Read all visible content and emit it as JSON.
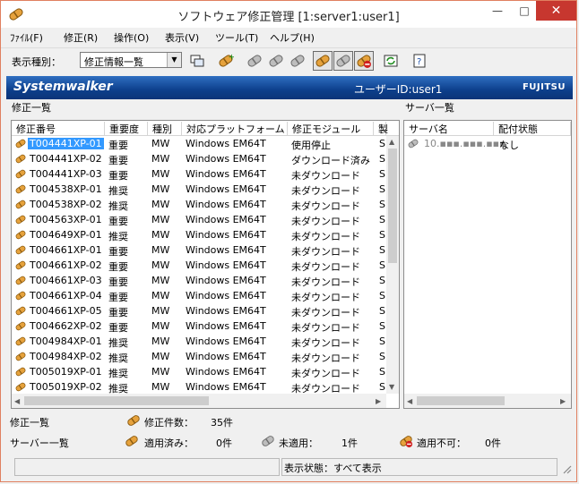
{
  "window": {
    "title": "ソフトウェア修正管理 [1:server1:user1]",
    "minimize_glyph": "—",
    "maximize_glyph": "□",
    "close_glyph": "✕"
  },
  "menu": [
    "ﾌｧｲﾙ(F)",
    "修正(R)",
    "操作(O)",
    "表示(V)",
    "ツール(T)",
    "ヘルプ(H)"
  ],
  "toolbar": {
    "display_type_label": "表示種別：",
    "display_type_value": "修正情報一覧"
  },
  "banner": {
    "logo": "Systemwalker",
    "user": "ユーザーID:user1",
    "vendor": "FUJITSU"
  },
  "patch_panel": {
    "title": "修正一覧",
    "columns": [
      "修正番号",
      "重要度",
      "種別",
      "対応プラットフォーム",
      "修正モジュール",
      "製"
    ],
    "rows": [
      {
        "id": "T004441XP-01",
        "importance": "重要",
        "type": "MW",
        "platform": "Windows EM64T",
        "module": "使用停止",
        "extra": "S"
      },
      {
        "id": "T004441XP-02",
        "importance": "重要",
        "type": "MW",
        "platform": "Windows EM64T",
        "module": "ダウンロード済み",
        "extra": "S"
      },
      {
        "id": "T004441XP-03",
        "importance": "重要",
        "type": "MW",
        "platform": "Windows EM64T",
        "module": "未ダウンロード",
        "extra": "S"
      },
      {
        "id": "T004538XP-01",
        "importance": "推奨",
        "type": "MW",
        "platform": "Windows EM64T",
        "module": "未ダウンロード",
        "extra": "S"
      },
      {
        "id": "T004538XP-02",
        "importance": "推奨",
        "type": "MW",
        "platform": "Windows EM64T",
        "module": "未ダウンロード",
        "extra": "S"
      },
      {
        "id": "T004563XP-01",
        "importance": "重要",
        "type": "MW",
        "platform": "Windows EM64T",
        "module": "未ダウンロード",
        "extra": "S"
      },
      {
        "id": "T004649XP-01",
        "importance": "推奨",
        "type": "MW",
        "platform": "Windows EM64T",
        "module": "未ダウンロード",
        "extra": "S"
      },
      {
        "id": "T004661XP-01",
        "importance": "重要",
        "type": "MW",
        "platform": "Windows EM64T",
        "module": "未ダウンロード",
        "extra": "S"
      },
      {
        "id": "T004661XP-02",
        "importance": "重要",
        "type": "MW",
        "platform": "Windows EM64T",
        "module": "未ダウンロード",
        "extra": "S"
      },
      {
        "id": "T004661XP-03",
        "importance": "重要",
        "type": "MW",
        "platform": "Windows EM64T",
        "module": "未ダウンロード",
        "extra": "S"
      },
      {
        "id": "T004661XP-04",
        "importance": "重要",
        "type": "MW",
        "platform": "Windows EM64T",
        "module": "未ダウンロード",
        "extra": "S"
      },
      {
        "id": "T004661XP-05",
        "importance": "重要",
        "type": "MW",
        "platform": "Windows EM64T",
        "module": "未ダウンロード",
        "extra": "S"
      },
      {
        "id": "T004662XP-02",
        "importance": "重要",
        "type": "MW",
        "platform": "Windows EM64T",
        "module": "未ダウンロード",
        "extra": "S"
      },
      {
        "id": "T004984XP-01",
        "importance": "推奨",
        "type": "MW",
        "platform": "Windows EM64T",
        "module": "未ダウンロード",
        "extra": "S"
      },
      {
        "id": "T004984XP-02",
        "importance": "推奨",
        "type": "MW",
        "platform": "Windows EM64T",
        "module": "未ダウンロード",
        "extra": "S"
      },
      {
        "id": "T005019XP-01",
        "importance": "推奨",
        "type": "MW",
        "platform": "Windows EM64T",
        "module": "未ダウンロード",
        "extra": "S"
      },
      {
        "id": "T005019XP-02",
        "importance": "推奨",
        "type": "MW",
        "platform": "Windows EM64T",
        "module": "未ダウンロード",
        "extra": "S"
      }
    ]
  },
  "server_panel": {
    "title": "サーバ一覧",
    "columns": [
      "サーバ名",
      "配付状態"
    ],
    "rows": [
      {
        "server": "10.▪▪▪.▪▪▪.▪▪▪",
        "state": "なし"
      }
    ]
  },
  "summary": {
    "patch_label": "修正一覧",
    "patch_count_label": "修正件数：",
    "patch_count_value": "35件",
    "server_label": "サーバー一覧",
    "applied_label": "適用済み：",
    "applied_value": "0件",
    "unapplied_label": "未適用：",
    "unapplied_value": "1件",
    "not_applicable_label": "適用不可：",
    "not_applicable_value": "0件"
  },
  "statusbar": {
    "display_state": "表示状態：すべて表示"
  },
  "colors": {
    "banner": "#0d3f8c",
    "selection": "#3399ff",
    "close_button": "#c7372f"
  }
}
